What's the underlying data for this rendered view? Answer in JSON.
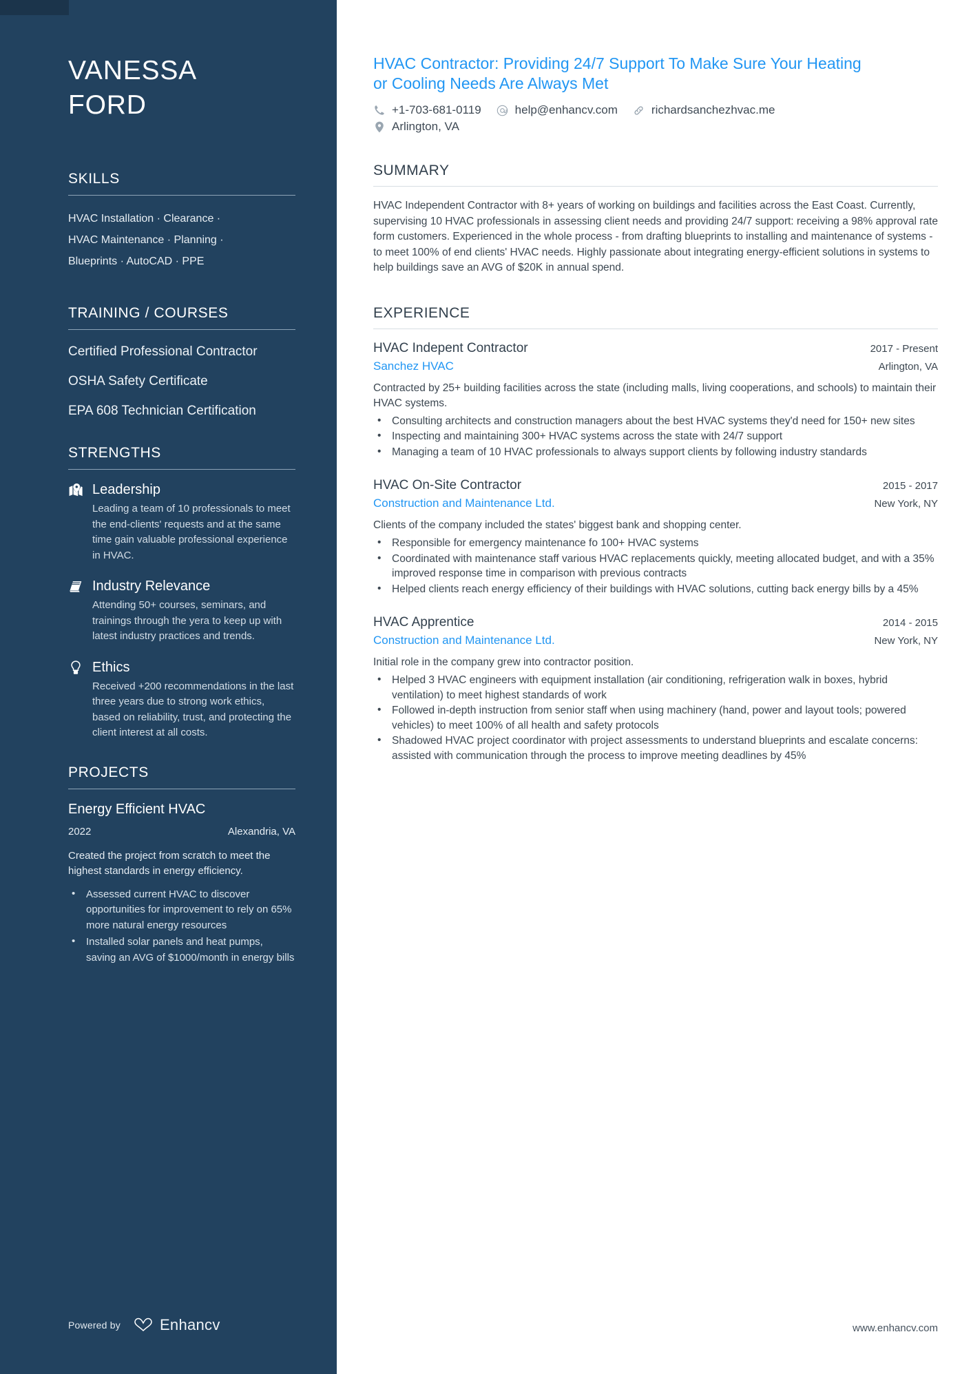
{
  "sidebar": {
    "name": {
      "first": "VANESSA",
      "last": "FORD"
    },
    "skills": {
      "heading": "SKILLS",
      "lines": [
        "HVAC Installation · Clearance ·",
        "HVAC Maintenance · Planning ·",
        "Blueprints · AutoCAD · PPE"
      ]
    },
    "training": {
      "heading": "TRAINING / COURSES",
      "items": [
        "Certified Professional Contractor",
        "OSHA Safety Certificate",
        "EPA 608 Technician Certification"
      ]
    },
    "strengths": {
      "heading": "STRENGTHS",
      "items": [
        {
          "icon": "map-pin-icon",
          "title": "Leadership",
          "desc": "Leading a team of 10 professionals to meet the end-clients' requests and at the same time gain valuable professional experience in HVAC."
        },
        {
          "icon": "book-icon",
          "title": "Industry Relevance",
          "desc": "Attending 50+ courses, seminars, and trainings through the yera to keep up with latest industry practices and trends."
        },
        {
          "icon": "lightbulb-icon",
          "title": "Ethics",
          "desc": "Received +200 recommendations in the last three years due to strong work ethics, based on reliability, trust, and protecting the client interest at all costs."
        }
      ]
    },
    "projects": {
      "heading": "PROJECTS",
      "items": [
        {
          "title": "Energy Efficient HVAC",
          "year": "2022",
          "location": "Alexandria, VA",
          "desc": "Created the project from scratch to meet the highest standards in energy efficiency.",
          "bullets": [
            "Assessed current HVAC to discover opportunities for improvement to rely on 65% more natural energy resources",
            "Installed solar panels and heat pumps, saving an AVG of $1000/month in energy bills"
          ]
        }
      ]
    },
    "footer": {
      "powered_by": "Powered by",
      "brand": "Enhancv"
    }
  },
  "main": {
    "headline": "HVAC Contractor: Providing 24/7 Support To Make Sure Your Heating or Cooling Needs Are Always Met",
    "contacts": [
      {
        "icon": "phone-icon",
        "value": "+1-703-681-0119"
      },
      {
        "icon": "email-icon",
        "value": "help@enhancv.com"
      },
      {
        "icon": "link-icon",
        "value": "richardsanchezhvac.me"
      },
      {
        "icon": "location-pin-icon",
        "value": "Arlington,  VA"
      }
    ],
    "summary": {
      "heading": "SUMMARY",
      "text": "HVAC Independent Contractor with 8+ years of working on buildings and facilities across the East Coast. Currently, supervising 10 HVAC professionals in assessing client needs and providing 24/7 support: receiving a 98% approval rate form customers. Experienced in the whole process - from drafting blueprints to installing and maintenance of systems - to meet 100% of end clients' HVAC needs. Highly passionate about integrating energy-efficient solutions in systems to help buildings save an AVG of $20K in annual spend."
    },
    "experience": {
      "heading": "EXPERIENCE",
      "jobs": [
        {
          "title": "HVAC Indepent Contractor",
          "dates": "2017 - Present",
          "company": "Sanchez HVAC",
          "location": "Arlington,  VA",
          "desc": "Contracted by 25+ building facilities across the state (including malls, living cooperations, and schools) to maintain their HVAC systems.",
          "bullets": [
            "Consulting architects and construction managers about the best HVAC systems they'd need for 150+ new sites",
            "Inspecting and maintaining 300+ HVAC systems across the state with 24/7 support",
            "Managing a team of 10 HVAC professionals to always support clients by following industry standards"
          ]
        },
        {
          "title": "HVAC On-Site Contractor",
          "dates": "2015 - 2017",
          "company": "Construction and Maintenance Ltd.",
          "location": "New York, NY",
          "desc": "Clients of the company included the states' biggest bank and shopping center.",
          "bullets": [
            "Responsible for emergency maintenance fo 100+ HVAC systems",
            "Coordinated with maintenance staff various HVAC replacements quickly, meeting allocated budget, and with a 35% improved response time in comparison with previous contracts",
            "Helped clients reach energy efficiency of their buildings with HVAC solutions, cutting back energy bills by a 45%"
          ]
        },
        {
          "title": "HVAC Apprentice",
          "dates": "2014 - 2015",
          "company": "Construction and Maintenance Ltd.",
          "location": "New York, NY",
          "desc": "Initial role in the company grew into contractor position.",
          "bullets": [
            "Helped 3 HVAC engineers with equipment installation (air conditioning, refrigeration walk in boxes, hybrid ventilation) to meet highest standards of work",
            "Followed in-depth instruction from senior staff when using machinery (hand, power and layout tools; powered vehicles) to meet 100% of all health and safety protocols",
            "Shadowed HVAC project coordinator with project assessments to understand blueprints and escalate concerns: assisted with communication through the process to improve meeting deadlines by 45%"
          ]
        }
      ]
    },
    "footer_url": "www.enhancv.com"
  },
  "colors": {
    "sidebar_bg": "#22425f",
    "accent_blue": "#2196f3",
    "heading_dark": "#32404d"
  }
}
